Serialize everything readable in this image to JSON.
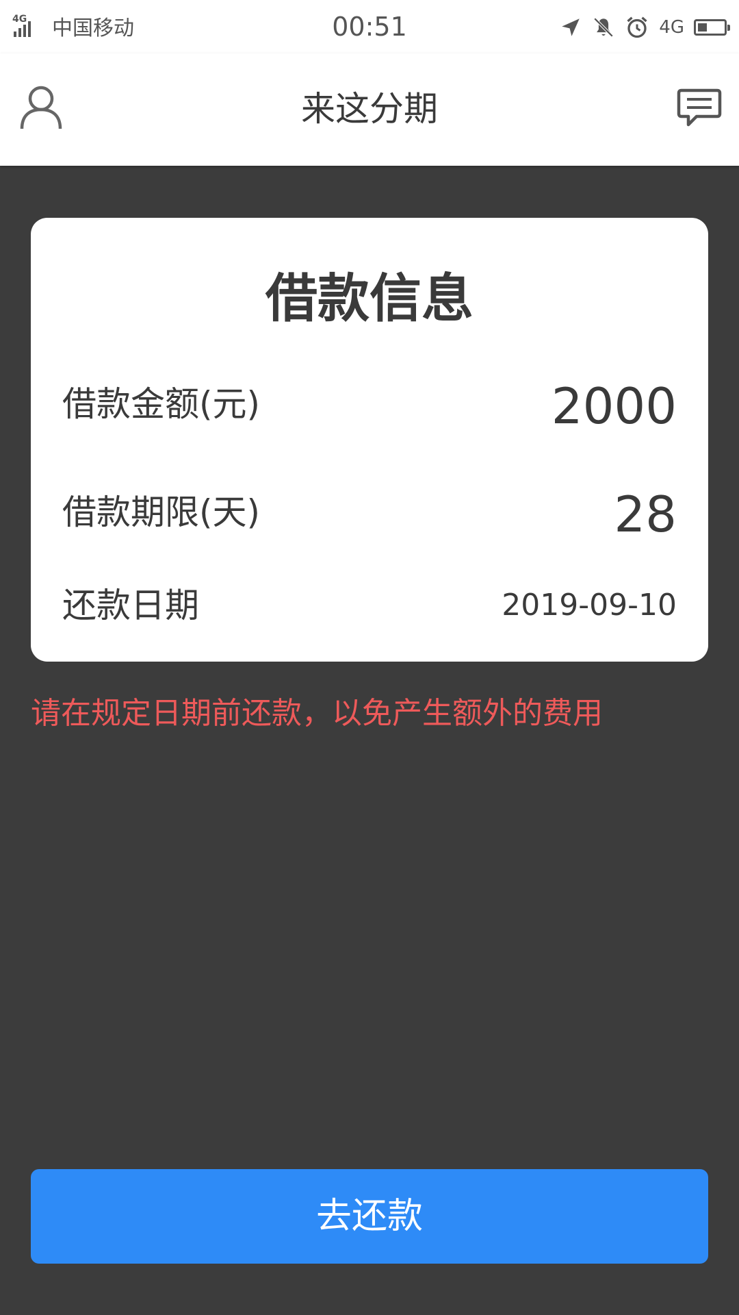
{
  "status_bar": {
    "network_tag": "4G",
    "carrier": "中国移动",
    "time": "00:51",
    "data_network": "4G",
    "battery_level": 0.35,
    "icons": [
      "signal-icon",
      "location-arrow-icon",
      "bell-muted-icon",
      "alarm-clock-icon",
      "battery-icon"
    ]
  },
  "app_bar": {
    "title": "来这分期",
    "left_icon": "user-profile-icon",
    "right_icon": "message-icon"
  },
  "loan_card": {
    "title": "借款信息",
    "rows": [
      {
        "label": "借款金额(元)",
        "value": "2000"
      },
      {
        "label": "借款期限(天)",
        "value": "28"
      },
      {
        "label": "还款日期",
        "value": "2019-09-10"
      }
    ]
  },
  "notice": "请在规定日期前还款，以免产生额外的费用",
  "repay_button": "去还款",
  "colors": {
    "background": "#3c3c3c",
    "card": "#ffffff",
    "notice": "#ee5a5a",
    "primary": "#2e8bf7",
    "text": "#3a3a3a"
  }
}
